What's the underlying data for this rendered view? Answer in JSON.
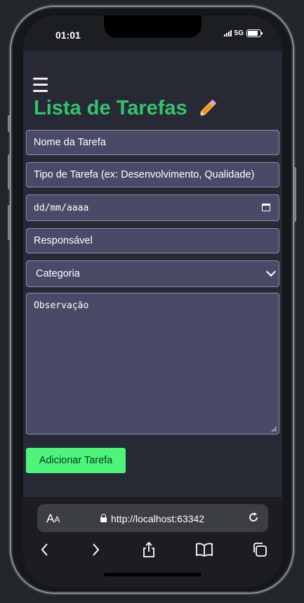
{
  "status": {
    "time": "01:01",
    "network": "5G"
  },
  "page": {
    "title": "Lista de Tarefas",
    "title_icon": "pencil-icon",
    "menu_icon": "hamburger-icon",
    "title_color": "#34c46b"
  },
  "form": {
    "task_name_placeholder": "Nome da Tarefa",
    "task_type_placeholder": "Tipo de Tarefa (ex: Desenvolvimento, Qualidade)",
    "date_placeholder": "dd/mm/aaaa",
    "responsible_placeholder": "Responsável",
    "category_selected": "Categoria",
    "notes_placeholder": "Observação",
    "submit_label": "Adicionar Tarefa",
    "button_color": "#4cf57a",
    "field_color": "#494b66"
  },
  "browser": {
    "text_size_label_big": "A",
    "text_size_label_small": "A",
    "url": "http://localhost:63342"
  }
}
